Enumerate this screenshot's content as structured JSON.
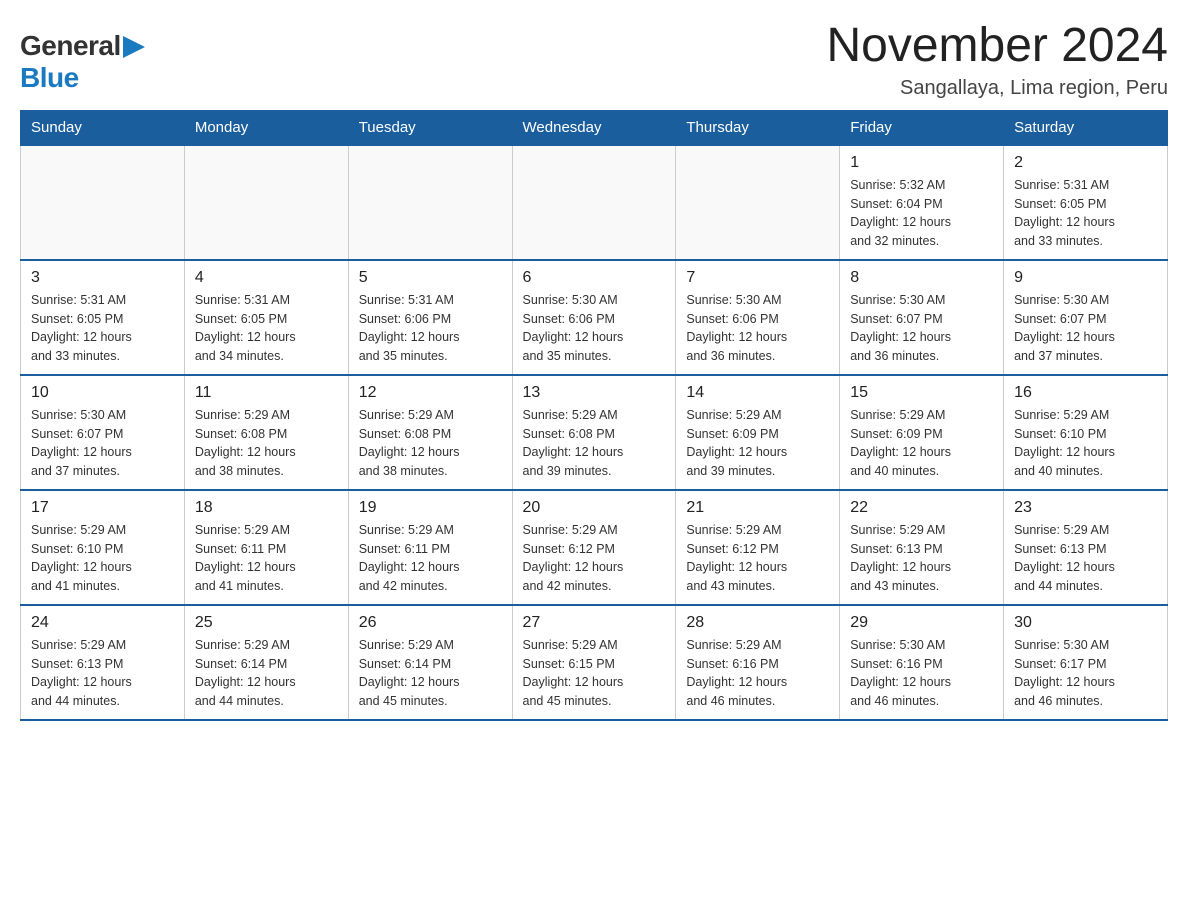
{
  "logo": {
    "general": "General",
    "blue": "Blue"
  },
  "title": "November 2024",
  "location": "Sangallaya, Lima region, Peru",
  "weekdays": [
    "Sunday",
    "Monday",
    "Tuesday",
    "Wednesday",
    "Thursday",
    "Friday",
    "Saturday"
  ],
  "weeks": [
    [
      {
        "day": "",
        "info": ""
      },
      {
        "day": "",
        "info": ""
      },
      {
        "day": "",
        "info": ""
      },
      {
        "day": "",
        "info": ""
      },
      {
        "day": "",
        "info": ""
      },
      {
        "day": "1",
        "info": "Sunrise: 5:32 AM\nSunset: 6:04 PM\nDaylight: 12 hours\nand 32 minutes."
      },
      {
        "day": "2",
        "info": "Sunrise: 5:31 AM\nSunset: 6:05 PM\nDaylight: 12 hours\nand 33 minutes."
      }
    ],
    [
      {
        "day": "3",
        "info": "Sunrise: 5:31 AM\nSunset: 6:05 PM\nDaylight: 12 hours\nand 33 minutes."
      },
      {
        "day": "4",
        "info": "Sunrise: 5:31 AM\nSunset: 6:05 PM\nDaylight: 12 hours\nand 34 minutes."
      },
      {
        "day": "5",
        "info": "Sunrise: 5:31 AM\nSunset: 6:06 PM\nDaylight: 12 hours\nand 35 minutes."
      },
      {
        "day": "6",
        "info": "Sunrise: 5:30 AM\nSunset: 6:06 PM\nDaylight: 12 hours\nand 35 minutes."
      },
      {
        "day": "7",
        "info": "Sunrise: 5:30 AM\nSunset: 6:06 PM\nDaylight: 12 hours\nand 36 minutes."
      },
      {
        "day": "8",
        "info": "Sunrise: 5:30 AM\nSunset: 6:07 PM\nDaylight: 12 hours\nand 36 minutes."
      },
      {
        "day": "9",
        "info": "Sunrise: 5:30 AM\nSunset: 6:07 PM\nDaylight: 12 hours\nand 37 minutes."
      }
    ],
    [
      {
        "day": "10",
        "info": "Sunrise: 5:30 AM\nSunset: 6:07 PM\nDaylight: 12 hours\nand 37 minutes."
      },
      {
        "day": "11",
        "info": "Sunrise: 5:29 AM\nSunset: 6:08 PM\nDaylight: 12 hours\nand 38 minutes."
      },
      {
        "day": "12",
        "info": "Sunrise: 5:29 AM\nSunset: 6:08 PM\nDaylight: 12 hours\nand 38 minutes."
      },
      {
        "day": "13",
        "info": "Sunrise: 5:29 AM\nSunset: 6:08 PM\nDaylight: 12 hours\nand 39 minutes."
      },
      {
        "day": "14",
        "info": "Sunrise: 5:29 AM\nSunset: 6:09 PM\nDaylight: 12 hours\nand 39 minutes."
      },
      {
        "day": "15",
        "info": "Sunrise: 5:29 AM\nSunset: 6:09 PM\nDaylight: 12 hours\nand 40 minutes."
      },
      {
        "day": "16",
        "info": "Sunrise: 5:29 AM\nSunset: 6:10 PM\nDaylight: 12 hours\nand 40 minutes."
      }
    ],
    [
      {
        "day": "17",
        "info": "Sunrise: 5:29 AM\nSunset: 6:10 PM\nDaylight: 12 hours\nand 41 minutes."
      },
      {
        "day": "18",
        "info": "Sunrise: 5:29 AM\nSunset: 6:11 PM\nDaylight: 12 hours\nand 41 minutes."
      },
      {
        "day": "19",
        "info": "Sunrise: 5:29 AM\nSunset: 6:11 PM\nDaylight: 12 hours\nand 42 minutes."
      },
      {
        "day": "20",
        "info": "Sunrise: 5:29 AM\nSunset: 6:12 PM\nDaylight: 12 hours\nand 42 minutes."
      },
      {
        "day": "21",
        "info": "Sunrise: 5:29 AM\nSunset: 6:12 PM\nDaylight: 12 hours\nand 43 minutes."
      },
      {
        "day": "22",
        "info": "Sunrise: 5:29 AM\nSunset: 6:13 PM\nDaylight: 12 hours\nand 43 minutes."
      },
      {
        "day": "23",
        "info": "Sunrise: 5:29 AM\nSunset: 6:13 PM\nDaylight: 12 hours\nand 44 minutes."
      }
    ],
    [
      {
        "day": "24",
        "info": "Sunrise: 5:29 AM\nSunset: 6:13 PM\nDaylight: 12 hours\nand 44 minutes."
      },
      {
        "day": "25",
        "info": "Sunrise: 5:29 AM\nSunset: 6:14 PM\nDaylight: 12 hours\nand 44 minutes."
      },
      {
        "day": "26",
        "info": "Sunrise: 5:29 AM\nSunset: 6:14 PM\nDaylight: 12 hours\nand 45 minutes."
      },
      {
        "day": "27",
        "info": "Sunrise: 5:29 AM\nSunset: 6:15 PM\nDaylight: 12 hours\nand 45 minutes."
      },
      {
        "day": "28",
        "info": "Sunrise: 5:29 AM\nSunset: 6:16 PM\nDaylight: 12 hours\nand 46 minutes."
      },
      {
        "day": "29",
        "info": "Sunrise: 5:30 AM\nSunset: 6:16 PM\nDaylight: 12 hours\nand 46 minutes."
      },
      {
        "day": "30",
        "info": "Sunrise: 5:30 AM\nSunset: 6:17 PM\nDaylight: 12 hours\nand 46 minutes."
      }
    ]
  ]
}
